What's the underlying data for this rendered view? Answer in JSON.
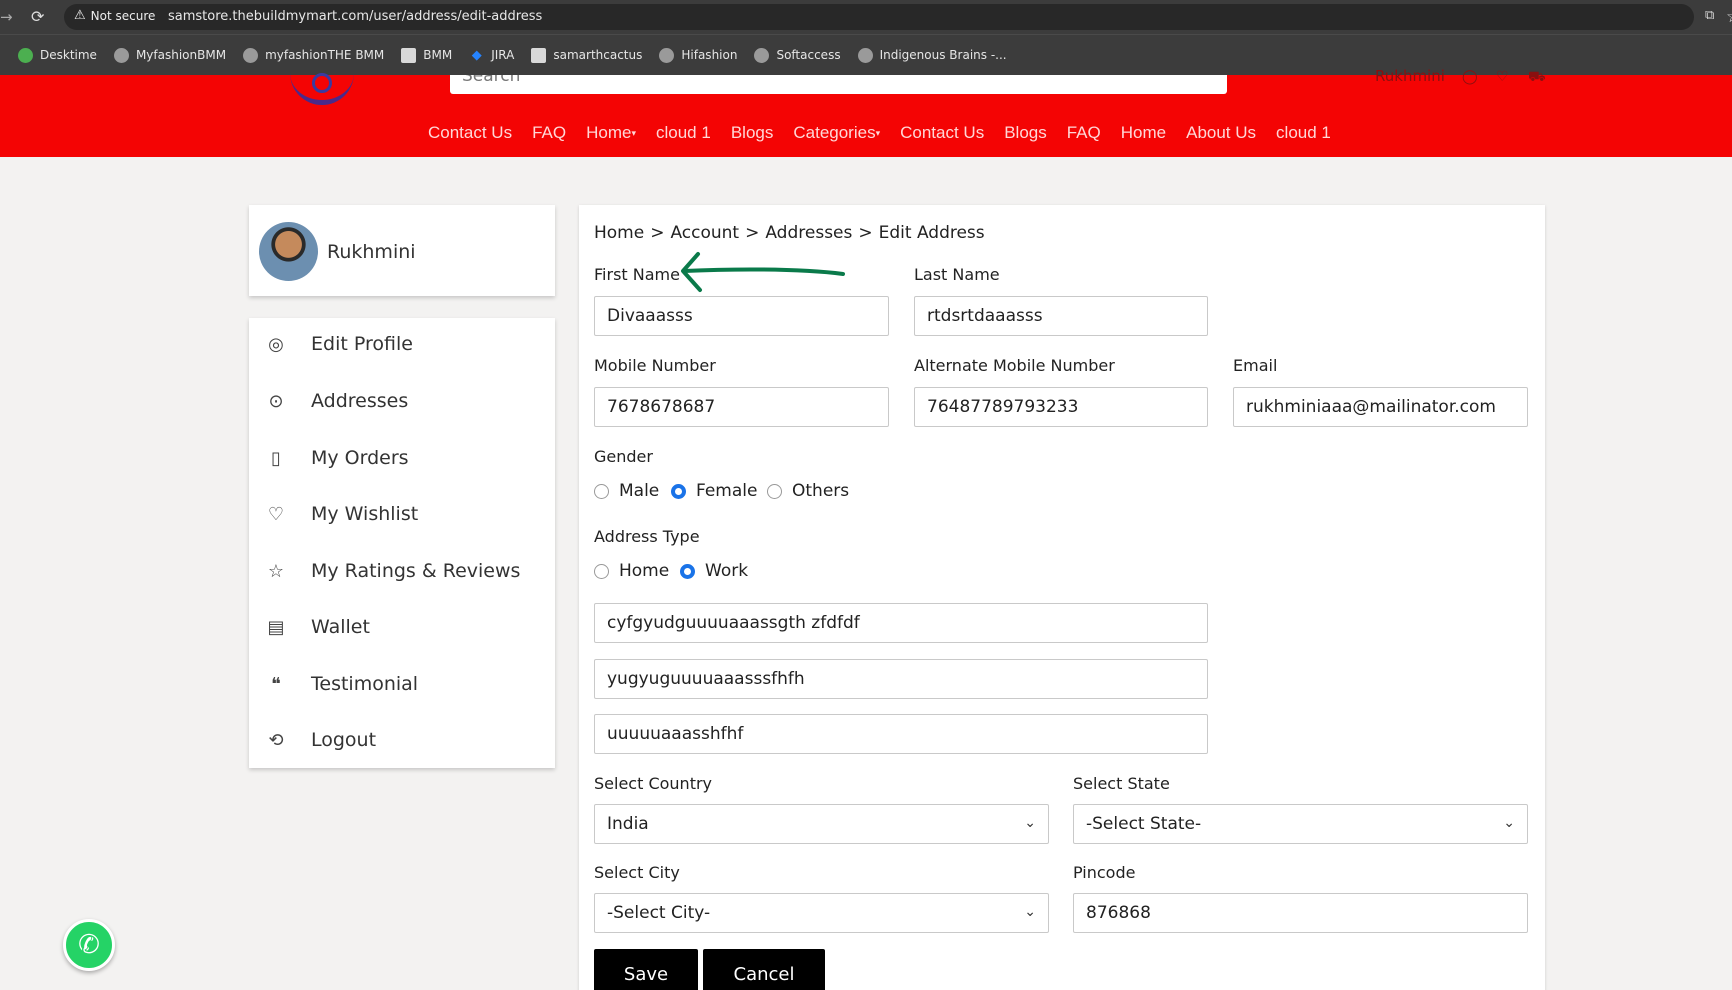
{
  "browser": {
    "security_label": "Not secure",
    "url": "samstore.thebuildmymart.com/user/address/edit-address",
    "bookmarks": [
      "Desktime",
      "MyfashionBMM",
      "myfashionTHE BMM",
      "BMM",
      "JIRA",
      "samarthcactus",
      "Hifashion",
      "Softaccess",
      "Indigenous Brains -..."
    ]
  },
  "header": {
    "search_placeholder": "Search",
    "user_name": "Rukhmini",
    "nav": [
      "Contact Us",
      "FAQ",
      "Home",
      "cloud 1",
      "Blogs",
      "Categories",
      "Contact Us",
      "Blogs",
      "FAQ",
      "Home",
      "About Us",
      "cloud 1"
    ],
    "brand_color": "#f40404"
  },
  "sidebar": {
    "profile_name": "Rukhmini",
    "items": [
      {
        "label": "Edit Profile",
        "icon": "user-icon"
      },
      {
        "label": "Addresses",
        "icon": "location-pin-icon"
      },
      {
        "label": "My Orders",
        "icon": "orders-icon"
      },
      {
        "label": "My Wishlist",
        "icon": "heart-icon"
      },
      {
        "label": "My Ratings & Reviews",
        "icon": "star-icon"
      },
      {
        "label": "Wallet",
        "icon": "wallet-icon"
      },
      {
        "label": "Testimonial",
        "icon": "quote-icon"
      },
      {
        "label": "Logout",
        "icon": "logout-icon"
      }
    ]
  },
  "form": {
    "breadcrumb": [
      "Home",
      ">",
      "Account",
      ">",
      "Addresses",
      ">",
      "Edit Address"
    ],
    "first_name_label": "First Name",
    "first_name": "Divaaasss",
    "last_name_label": "Last Name",
    "last_name": "rtdsrtdaaasss",
    "mobile_label": "Mobile Number",
    "mobile": "7678678687",
    "alt_mobile_label": "Alternate Mobile Number",
    "alt_mobile": "76487789793233",
    "email_label": "Email",
    "email": "rukhminiaaa@mailinator.com",
    "gender_label": "Gender",
    "gender_options": [
      "Male",
      "Female",
      "Others"
    ],
    "gender_selected": "Female",
    "address_type_label": "Address Type",
    "address_type_options": [
      "Home",
      "Work"
    ],
    "address_type_selected": "Work",
    "address_line1": "cyfgyudguuuuaaassgth zfdfdf",
    "address_line2": "yugyuguuuuaaasssfhfh",
    "address_line3": "uuuuuaaasshfhf",
    "country_label": "Select Country",
    "country": "India",
    "state_label": "Select State",
    "state": "-Select State-",
    "city_label": "Select City",
    "city": "-Select City-",
    "pincode_label": "Pincode",
    "pincode": "876868",
    "save_label": "Save",
    "cancel_label": "Cancel"
  },
  "annotation": {
    "arrow_color": "#0a7a4a"
  }
}
